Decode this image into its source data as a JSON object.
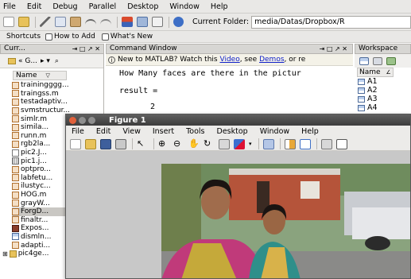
{
  "menubar": {
    "items": [
      "File",
      "Edit",
      "Debug",
      "Parallel",
      "Desktop",
      "Window",
      "Help"
    ]
  },
  "toolbar": {
    "current_folder_label": "Current Folder:",
    "current_folder_path": "media/Datas/Dropbox/R"
  },
  "shortcuts": {
    "items": [
      "Shortcuts",
      "How to Add",
      "What's New"
    ]
  },
  "current_folder_panel": {
    "title": "Curr...",
    "path_crumb": "« G...",
    "column_header": "Name",
    "files": [
      "trainingggg...",
      "traingss.m",
      "testadaptiv...",
      "svmstructur...",
      "simlr.m",
      "simila...",
      "runn.m",
      "rgb2la...",
      "pic2.J...",
      "pic1.j...",
      "optpro...",
      "labfetu...",
      "ilustyc...",
      "HOG.m",
      "grayW...",
      "ForgD...",
      "finaltr...",
      "Expos...",
      "dismln...",
      "adapti...",
      "pic4ge..."
    ]
  },
  "command_window": {
    "title": "Command Window",
    "info_prefix": "New to MATLAB? Watch this",
    "info_link1": "Video",
    "info_mid": ", see",
    "info_link2": "Demos",
    "info_suffix": ", or re",
    "lines": [
      "How Many faces are there in the pictur",
      "result =",
      "2"
    ]
  },
  "workspace": {
    "title": "Workspace",
    "column_header": "Name",
    "vars": [
      "A1",
      "A2",
      "A3",
      "A4"
    ]
  },
  "figure": {
    "title": "Figure 1",
    "menu": [
      "File",
      "Edit",
      "View",
      "Insert",
      "Tools",
      "Desktop",
      "Window",
      "Help"
    ]
  }
}
